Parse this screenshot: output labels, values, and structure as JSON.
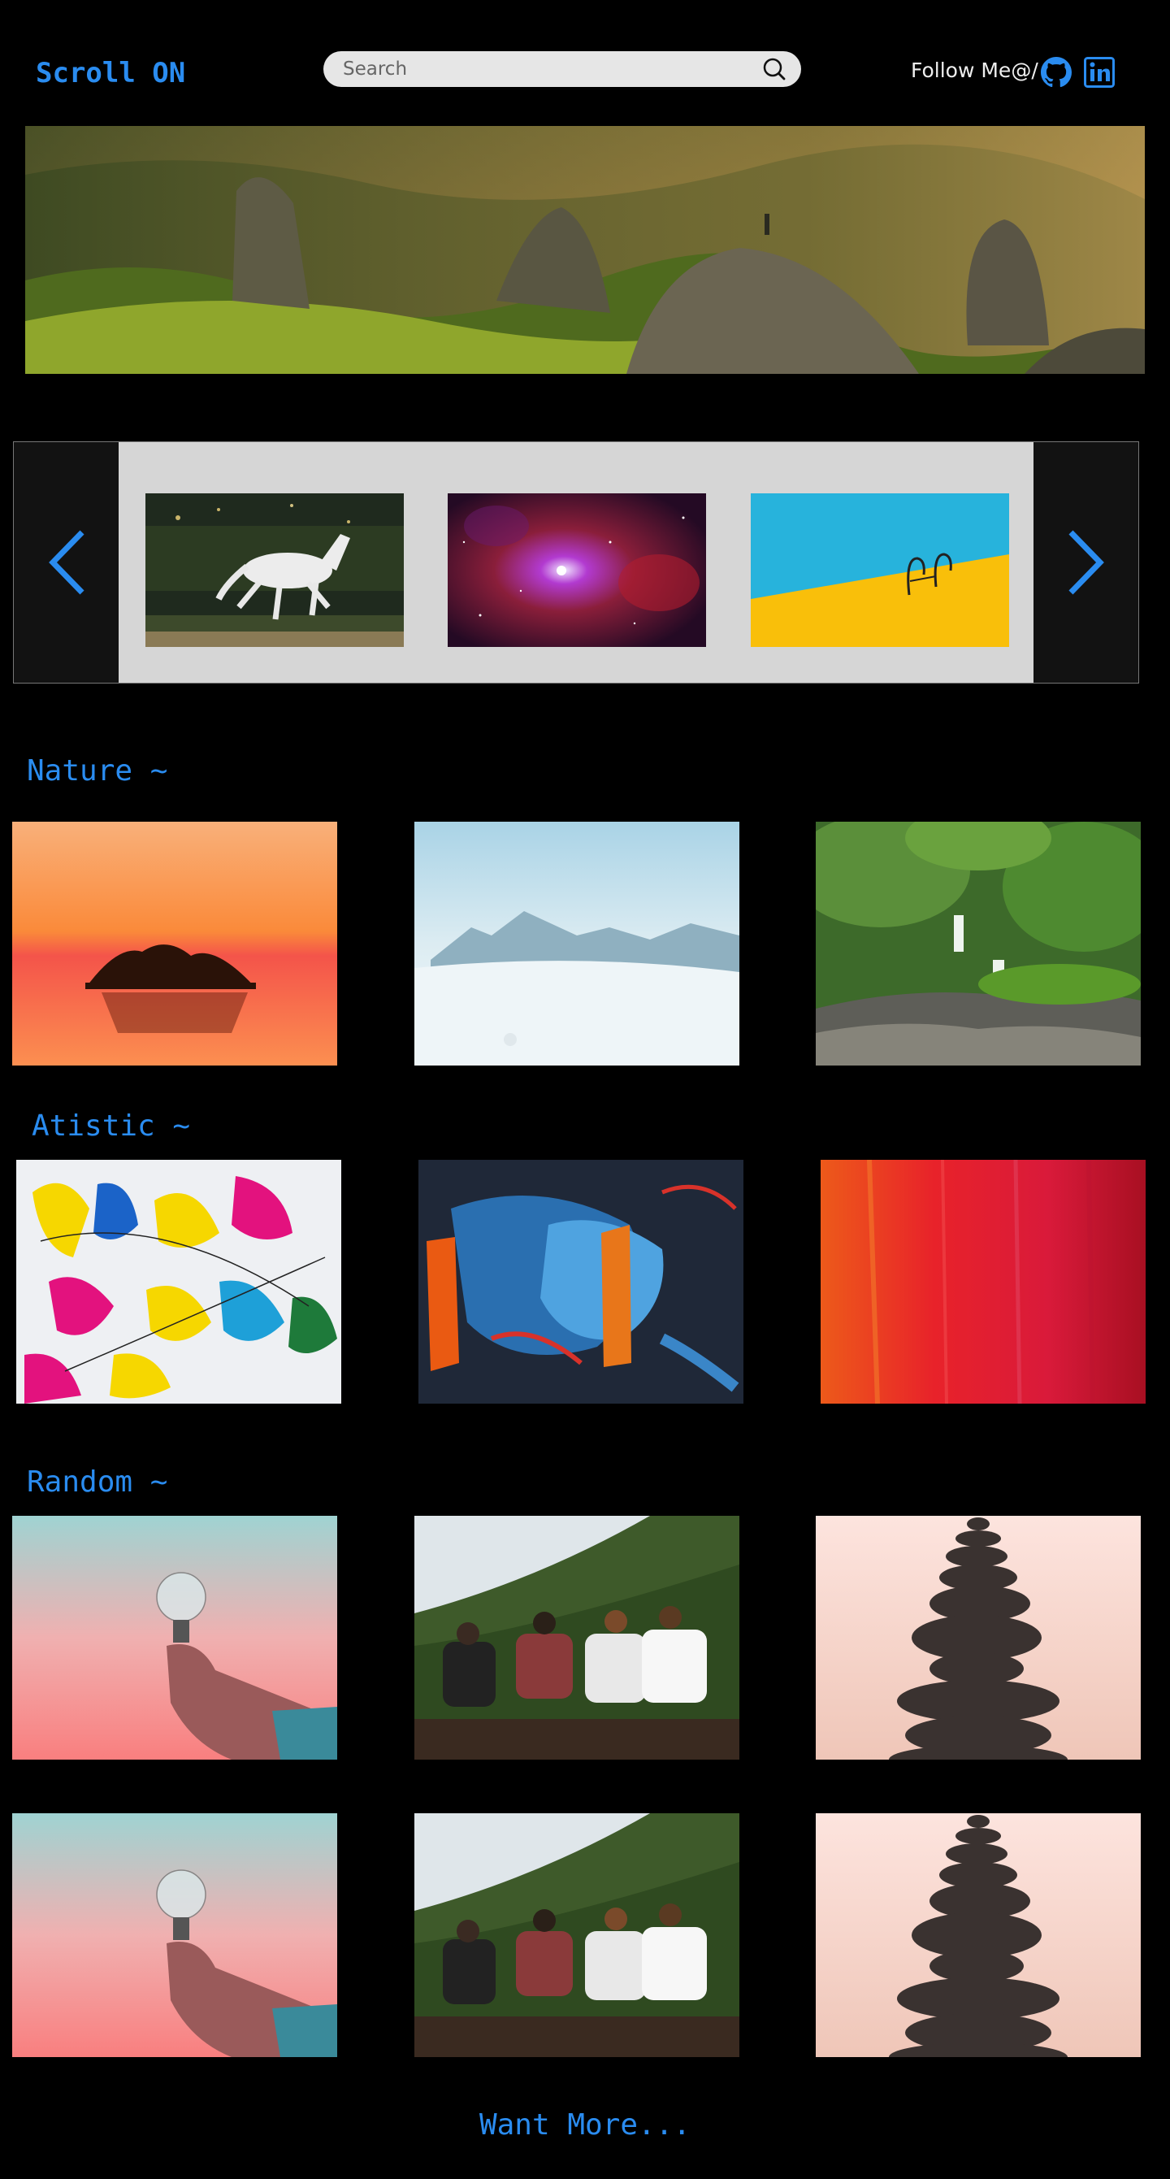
{
  "header": {
    "logo": "Scroll ON",
    "search_placeholder": "Search",
    "follow_text": "Follow Me@/"
  },
  "hero": {
    "alt": "Mountain landscape with rocky peaks at sunset"
  },
  "carousel": {
    "images": [
      {
        "alt": "White horse running in a forest"
      },
      {
        "alt": "Red and purple nebula in space"
      },
      {
        "alt": "Swimming pool ladder on blue and yellow"
      }
    ]
  },
  "sections": {
    "nature": "Nature ~",
    "artistic": "Atistic ~",
    "random": "Random ~"
  },
  "footer": {
    "want_more": "Want More..."
  },
  "colors": {
    "accent": "#2a8cf0",
    "background": "#000000",
    "carousel_bg": "#d6d6d6"
  },
  "icons": [
    "search-icon",
    "github-icon",
    "linkedin-icon",
    "chevron-left-icon",
    "chevron-right-icon"
  ]
}
